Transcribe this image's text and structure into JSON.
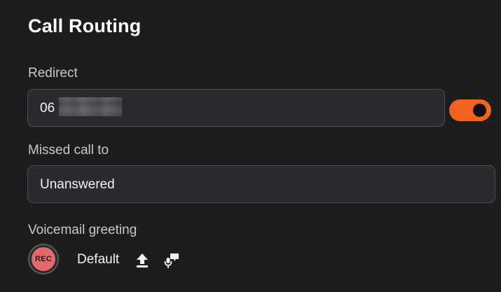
{
  "page": {
    "title": "Call Routing"
  },
  "redirect": {
    "label": "Redirect",
    "value": "06",
    "enabled": true
  },
  "missed_call": {
    "label": "Missed call to",
    "value": "Unanswered"
  },
  "voicemail": {
    "label": "Voicemail greeting",
    "record_label": "REC",
    "greeting_name": "Default",
    "icons": [
      "upload-icon",
      "microphone-speech-icon"
    ]
  },
  "colors": {
    "background": "#1c1d1f",
    "field_bg": "#2a2b2e",
    "field_border": "#4e4f53",
    "accent": "#f26322",
    "record": "#e46a6a"
  }
}
